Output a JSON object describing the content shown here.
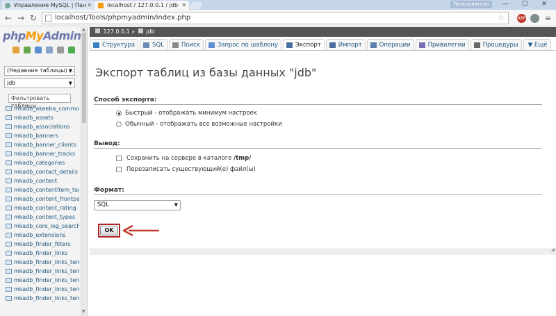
{
  "browser": {
    "tabs": [
      {
        "title": "Управление MySQL | Пан",
        "active": false
      },
      {
        "title": "localhost / 127.0.0.1 / jdb",
        "active": true
      }
    ],
    "user_badge": "Пользователь",
    "window_buttons": [
      "—",
      "☐",
      "✕"
    ],
    "url": "localhost/Tools/phpmyadmin/index.php",
    "extensions": [
      {
        "name": "adblock-icon",
        "label": "ABP",
        "color": "#c0392b"
      },
      {
        "name": "clock-icon",
        "label": "",
        "color": "#7f8c8d"
      },
      {
        "name": "menu-icon",
        "label": "",
        "color": "#7f8c8d"
      }
    ]
  },
  "sidebar": {
    "logo": {
      "php": "php",
      "my": "My",
      "admin": "Admin"
    },
    "recent_tables": "(Недавние таблицы) ...",
    "database": "jdb",
    "filter_placeholder": "Фильтровать таблицы",
    "tables": [
      "mkadb_akeeba_common",
      "mkadb_assets",
      "mkadb_associations",
      "mkadb_banners",
      "mkadb_banner_clients",
      "mkadb_banner_tracks",
      "mkadb_categories",
      "mkadb_contact_details",
      "mkadb_content",
      "mkadb_contentitem_tag_m",
      "mkadb_content_frontpage",
      "mkadb_content_rating",
      "mkadb_content_types",
      "mkadb_core_log_searches",
      "mkadb_extensions",
      "mkadb_finder_filters",
      "mkadb_finder_links",
      "mkadb_finder_links_terms",
      "mkadb_finder_links_terms",
      "mkadb_finder_links_terms",
      "mkadb_finder_links_terms",
      "mkadb_finder_links_terms"
    ]
  },
  "main": {
    "breadcrumb": {
      "server": "127.0.0.1",
      "sep": "»",
      "db": "jdb"
    },
    "tabs": [
      {
        "label": "Структура",
        "icon": "structure-icon",
        "color": "#3b7fc4"
      },
      {
        "label": "SQL",
        "icon": "sql-icon",
        "color": "#6a8bb5"
      },
      {
        "label": "Поиск",
        "icon": "search-icon",
        "color": "#888888"
      },
      {
        "label": "Запрос по шаблону",
        "icon": "query-icon",
        "color": "#5b8fd0"
      },
      {
        "label": "Экспорт",
        "icon": "export-icon",
        "color": "#4a6fa0",
        "active": true
      },
      {
        "label": "Импорт",
        "icon": "import-icon",
        "color": "#4a6fa0"
      },
      {
        "label": "Операции",
        "icon": "operations-icon",
        "color": "#5a7fa8"
      },
      {
        "label": "Привилегии",
        "icon": "privileges-icon",
        "color": "#7a6fb0"
      },
      {
        "label": "Процедуры",
        "icon": "routines-icon",
        "color": "#666666"
      },
      {
        "label": "Ещё",
        "icon": "more-icon",
        "color": "#555555"
      }
    ],
    "title": "Экспорт таблиц из базы данных \"jdb\"",
    "export_method": {
      "title": "Способ экспорта:",
      "options": [
        {
          "label": "Быстрый - отображать минимум настроек",
          "checked": true
        },
        {
          "label": "Обычный - отображать все возможные настройки",
          "checked": false
        }
      ]
    },
    "output": {
      "title": "Вывод:",
      "save_prefix": "Сохранить на сервере в каталоге ",
      "save_dir": "/tmp/",
      "overwrite": "Перезаписать существующий(е) файл(ы)"
    },
    "format": {
      "title": "Формат:",
      "selected": "SQL"
    },
    "ok_label": "OK",
    "highlight_color": "#b22222"
  }
}
